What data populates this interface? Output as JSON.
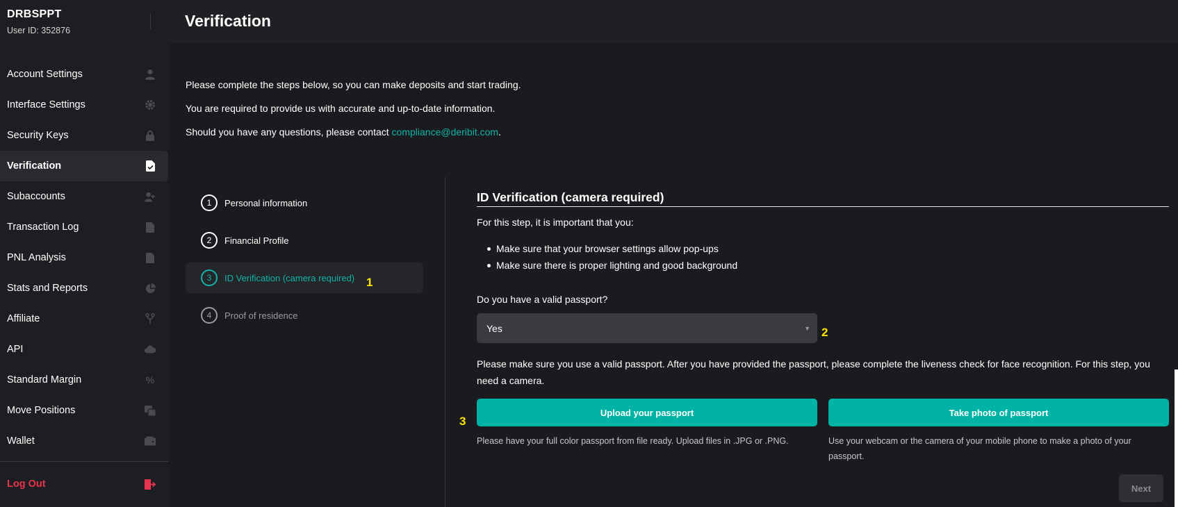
{
  "user": {
    "name": "DRBSPPT",
    "id_label": "User ID: 352876"
  },
  "sidebar": {
    "items": [
      {
        "label": "Account Settings",
        "icon": "user-icon"
      },
      {
        "label": "Interface Settings",
        "icon": "gear-icon"
      },
      {
        "label": "Security Keys",
        "icon": "lock-icon"
      },
      {
        "label": "Verification",
        "icon": "document-check-icon",
        "active": true
      },
      {
        "label": "Subaccounts",
        "icon": "users-icon"
      },
      {
        "label": "Transaction Log",
        "icon": "document-icon"
      },
      {
        "label": "PNL Analysis",
        "icon": "document-icon"
      },
      {
        "label": "Stats and Reports",
        "icon": "pie-chart-icon"
      },
      {
        "label": "Affiliate",
        "icon": "fork-icon"
      },
      {
        "label": "API",
        "icon": "cloud-icon"
      },
      {
        "label": "Standard Margin",
        "icon": "percent-icon"
      },
      {
        "label": "Move Positions",
        "icon": "move-icon"
      },
      {
        "label": "Wallet",
        "icon": "wallet-icon"
      }
    ],
    "logout": {
      "label": "Log Out",
      "icon": "logout-icon"
    }
  },
  "header": {
    "title": "Verification"
  },
  "intro": {
    "line1": "Please complete the steps below, so you can make deposits and start trading.",
    "line2": "You are required to provide us with accurate and up-to-date information.",
    "line3_prefix": "Should you have any questions, please contact ",
    "line3_email": "compliance@deribit.com",
    "line3_suffix": "."
  },
  "steps": [
    {
      "num": "1",
      "label": "Personal information",
      "state": "done"
    },
    {
      "num": "2",
      "label": "Financial Profile",
      "state": "done"
    },
    {
      "num": "3",
      "label": "ID Verification (camera required)",
      "state": "active"
    },
    {
      "num": "4",
      "label": "Proof of residence",
      "state": "disabled"
    }
  ],
  "markers": {
    "m1": "1",
    "m2": "2",
    "m3": "3"
  },
  "panel": {
    "title": "ID Verification (camera required)",
    "lead": "For this step, it is important that you:",
    "bullets": [
      "Make sure that your browser settings allow pop-ups",
      "Make sure there is proper lighting and good background"
    ],
    "question": "Do you have a valid passport?",
    "select_value": "Yes",
    "note": "Please make sure you use a valid passport. After you have provided the passport, please complete the liveness check for face recognition. For this step, you need a camera.",
    "upload_button": "Upload your passport",
    "photo_button": "Take photo of passport",
    "upload_hint": "Please have your full color passport from file ready. Upload files in .JPG or .PNG.",
    "photo_hint": "Use your webcam or the camera of your mobile phone to make a photo of your passport.",
    "next_button": "Next"
  },
  "colors": {
    "accent": "#00b3a4",
    "link": "#10b4a7",
    "logout": "#e8344e",
    "marker": "#ffe500",
    "background": "#1a1b1e"
  }
}
